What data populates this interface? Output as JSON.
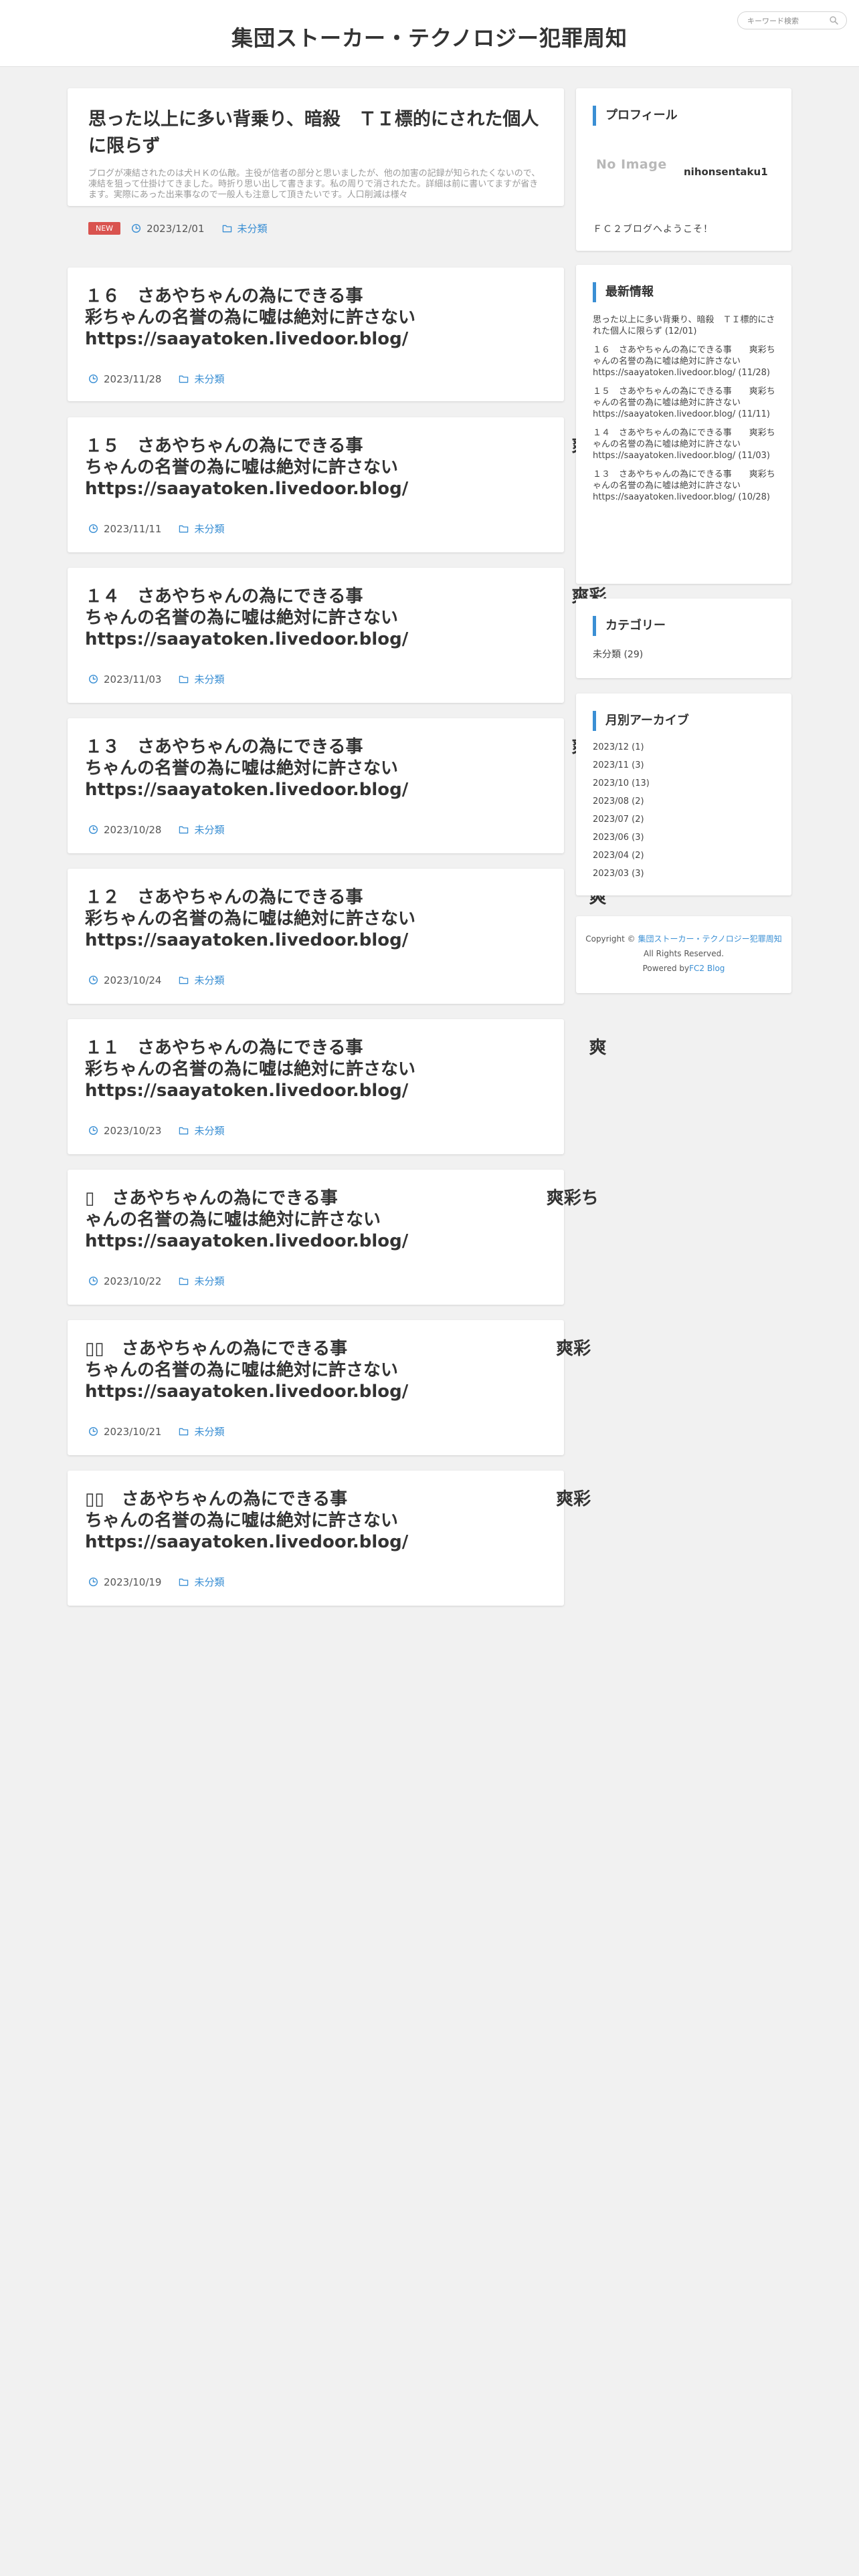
{
  "header": {
    "site_title": "集団ストーカー・テクノロジー犯罪周知",
    "search_placeholder": "キーワード検索"
  },
  "feature": {
    "title": "思った以上に多い背乗り、暗殺　ＴＩ標的にされた個人に限らず",
    "excerpt": "ブログが凍結されたのは犬ＨＫの仏敵。主役が信者の部分と思いましたが、他の加害の記録が知られたくないので、凍結を狙って仕掛けてきました。時折り思い出して書きます。私の周りで消されたた。詳細は前に書いてますが省きます。実際にあった出来事なので一般人も注意して頂きたいです。人口削減は様々",
    "badge": "NEW",
    "date": "2023/12/01",
    "category": "未分類"
  },
  "posts": [
    {
      "title": "１６　さあやちゃんの為にできる事　　　　　　　　　　　　　爽\n彩ちゃんの名誉の為に嘘は絶対に許さない\nhttps://saayatoken.livedoor.blog/",
      "date": "2023/11/28",
      "category": "未分類"
    },
    {
      "title": "１５　さあやちゃんの為にできる事　　　　　　　　　　　　爽彩\nちゃんの名誉の為に嘘は絶対に許さない\nhttps://saayatoken.livedoor.blog/",
      "date": "2023/11/11",
      "category": "未分類"
    },
    {
      "title": "１４　さあやちゃんの為にできる事　　　　　　　　　　　　爽彩\nちゃんの名誉の為に嘘は絶対に許さない\nhttps://saayatoken.livedoor.blog/",
      "date": "2023/11/03",
      "category": "未分類"
    },
    {
      "title": "１３　さあやちゃんの為にできる事　　　　　　　　　　　　爽彩\nちゃんの名誉の為に嘘は絶対に許さない\nhttps://saayatoken.livedoor.blog/",
      "date": "2023/10/28",
      "category": "未分類"
    },
    {
      "title": "１２　さあやちゃんの為にできる事　　　　　　　　　　　　　爽\n彩ちゃんの名誉の為に嘘は絶対に許さない\nhttps://saayatoken.livedoor.blog/",
      "date": "2023/10/24",
      "category": "未分類"
    },
    {
      "title": "１１　さあやちゃんの為にできる事　　　　　　　　　　　　　爽\n彩ちゃんの名誉の為に嘘は絶対に許さない\nhttps://saayatoken.livedoor.blog/",
      "date": "2023/10/23",
      "category": "未分類"
    },
    {
      "title": "▯　さあやちゃんの為にできる事　　　　　　　　　　　　爽彩ち\nゃんの名誉の為に嘘は絶対に許さない\nhttps://saayatoken.livedoor.blog/",
      "date": "2023/10/22",
      "category": "未分類"
    },
    {
      "title": "▯▯　さあやちゃんの為にできる事　　　　　　　　　　　　爽彩\nちゃんの名誉の為に嘘は絶対に許さない\nhttps://saayatoken.livedoor.blog/",
      "date": "2023/10/21",
      "category": "未分類"
    },
    {
      "title": "▯▯　さあやちゃんの為にできる事　　　　　　　　　　　　爽彩\nちゃんの名誉の為に嘘は絶対に許さない\nhttps://saayatoken.livedoor.blog/",
      "date": "2023/10/19",
      "category": "未分類"
    }
  ],
  "sidebar": {
    "profile": {
      "heading": "プロフィール",
      "noimage": "No Image",
      "username": "nihonsentaku1",
      "welcome": "ＦＣ２ブログへようこそ！"
    },
    "recent": {
      "heading": "最新情報",
      "items": [
        "思った以上に多い背乗り、暗殺　ＴＩ標的にされた個人に限らず (12/01)",
        "１６　さあやちゃんの為にできる事　　爽彩ちゃんの名誉の為に嘘は絶対に許さないhttps://saayatoken.livedoor.blog/ (11/28)",
        "１５　さあやちゃんの為にできる事　　爽彩ちゃんの名誉の為に嘘は絶対に許さないhttps://saayatoken.livedoor.blog/ (11/11)",
        "１４　さあやちゃんの為にできる事　　爽彩ちゃんの名誉の為に嘘は絶対に許さないhttps://saayatoken.livedoor.blog/ (11/03)",
        "１３　さあやちゃんの為にできる事　　爽彩ちゃんの名誉の為に嘘は絶対に許さないhttps://saayatoken.livedoor.blog/ (10/28)"
      ]
    },
    "categories": {
      "heading": "カテゴリー",
      "item": "未分類 (29)"
    },
    "archives": {
      "heading": "月別アーカイブ",
      "items": [
        "2023/12 (1)",
        "2023/11 (3)",
        "2023/10 (13)",
        "2023/08 (2)",
        "2023/07 (2)",
        "2023/06 (3)",
        "2023/04 (2)",
        "2023/03 (3)"
      ]
    },
    "footer": {
      "copyright_prefix": "Copyright © ",
      "copyright_link": "集団ストーカー・テクノロジー犯罪周知",
      "rights": "All Rights Reserved.",
      "powered_prefix": "Powered by",
      "powered_link": "FC2 Blog"
    }
  },
  "colors": {
    "accent": "#3a8fd4",
    "badge": "#d9534f",
    "background": "#f1f1f1"
  }
}
